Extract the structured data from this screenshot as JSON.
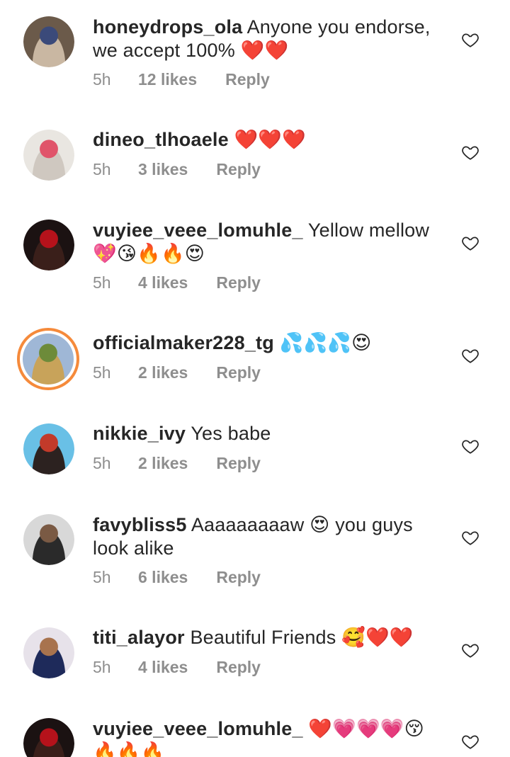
{
  "comments": [
    {
      "username": "honeydrops_ola",
      "text": "Anyone you endorse, we accept 100% ❤️❤️",
      "time": "5h",
      "likes": "12 likes",
      "reply_label": "Reply",
      "heart_icon": "heart-outline-icon",
      "avatar_colors": [
        "#6b5a4a",
        "#c9b7a2",
        "#3b4a7a"
      ],
      "story_ring": false
    },
    {
      "username": "dineo_tlhoaele",
      "text": "❤️❤️❤️",
      "time": "5h",
      "likes": "3 likes",
      "reply_label": "Reply",
      "heart_icon": "heart-outline-icon",
      "avatar_colors": [
        "#e9e6e1",
        "#cfc8c0",
        "#e0546a"
      ],
      "story_ring": false
    },
    {
      "username": "vuyiee_veee_lomuhle_",
      "text": "Yellow mellow 💖😘🔥🔥😍",
      "time": "5h",
      "likes": "4 likes",
      "reply_label": "Reply",
      "heart_icon": "heart-outline-icon",
      "avatar_colors": [
        "#1b1212",
        "#3a1f1a",
        "#b5121b"
      ],
      "story_ring": false
    },
    {
      "username": "officialmaker228_tg",
      "text": "💦💦💦😍",
      "time": "5h",
      "likes": "2 likes",
      "reply_label": "Reply",
      "heart_icon": "heart-outline-icon",
      "avatar_colors": [
        "#9fb7d6",
        "#c8a35a",
        "#6d8b3a"
      ],
      "story_ring": true
    },
    {
      "username": "nikkie_ivy",
      "text": "Yes babe",
      "time": "5h",
      "likes": "2 likes",
      "reply_label": "Reply",
      "heart_icon": "heart-outline-icon",
      "avatar_colors": [
        "#69c0e6",
        "#2c2220",
        "#c23a2a"
      ],
      "story_ring": false
    },
    {
      "username": "favybliss5",
      "text": "Aaaaaaaaaw 😍 you guys look alike",
      "time": "5h",
      "likes": "6 likes",
      "reply_label": "Reply",
      "heart_icon": "heart-outline-icon",
      "avatar_colors": [
        "#d8d8d8",
        "#2a2a2a",
        "#7a5a44"
      ],
      "story_ring": false
    },
    {
      "username": "titi_alayor",
      "text": "Beautiful Friends 🥰❤️❤️",
      "time": "5h",
      "likes": "4 likes",
      "reply_label": "Reply",
      "heart_icon": "heart-outline-icon",
      "avatar_colors": [
        "#e7e2ea",
        "#1e2a5a",
        "#a8734e"
      ],
      "story_ring": false
    },
    {
      "username": "vuyiee_veee_lomuhle_",
      "text": "❤️💗💗💗😚🔥🔥🔥",
      "time": "",
      "likes": "",
      "reply_label": "",
      "heart_icon": "heart-outline-icon",
      "avatar_colors": [
        "#1b1212",
        "#3a1f1a",
        "#b5121b"
      ],
      "story_ring": false
    }
  ],
  "colors": {
    "text_primary": "#262626",
    "text_secondary": "#8e8e8e",
    "story_ring": "#f58a3b"
  }
}
